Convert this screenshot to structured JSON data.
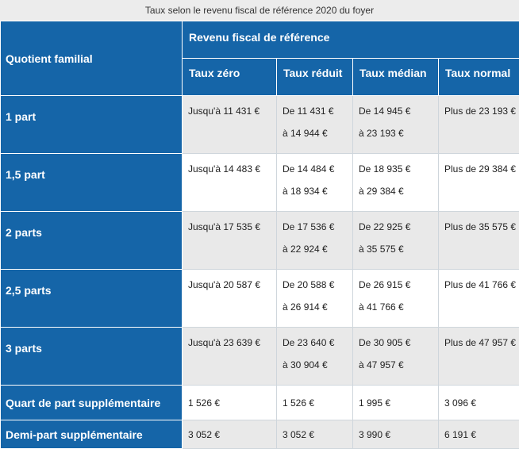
{
  "caption": "Taux selon le revenu fiscal de référence 2020 du foyer",
  "header": {
    "quotient": "Quotient familial",
    "revenu": "Revenu fiscal de référence",
    "columns": [
      "Taux zéro",
      "Taux réduit",
      "Taux médian",
      "Taux normal"
    ]
  },
  "rows": [
    {
      "label": "1 part",
      "zero": "Jusqu'à 11 431 €",
      "reduit_1": "De 11 431 €",
      "reduit_2": "à 14 944 €",
      "median_1": "De 14 945 €",
      "median_2": "à 23 193 €",
      "normal": "Plus de 23 193 €"
    },
    {
      "label": "1,5 part",
      "zero": "Jusqu'à 14 483 €",
      "reduit_1": "De 14 484 €",
      "reduit_2": "à 18 934 €",
      "median_1": "De 18 935 €",
      "median_2": "à 29 384 €",
      "normal": "Plus de 29 384 €"
    },
    {
      "label": "2 parts",
      "zero": "Jusqu'à 17 535 €",
      "reduit_1": "De 17 536 €",
      "reduit_2": "à 22 924 €",
      "median_1": "De 22 925 €",
      "median_2": "à 35 575 €",
      "normal": "Plus de 35 575 €"
    },
    {
      "label": "2,5 parts",
      "zero": "Jusqu'à 20 587 €",
      "reduit_1": "De 20 588 €",
      "reduit_2": "à 26 914 €",
      "median_1": "De 26 915 €",
      "median_2": "à 41 766 €",
      "normal": "Plus de 41 766 €"
    },
    {
      "label": "3 parts",
      "zero": "Jusqu'à 23 639 €",
      "reduit_1": "De 23 640 €",
      "reduit_2": "à 30 904 €",
      "median_1": "De 30 905 €",
      "median_2": "à 47 957 €",
      "normal": "Plus de 47 957 €"
    },
    {
      "label": "Quart de part supplémentaire",
      "zero": "1 526 €",
      "reduit": "1 526 €",
      "median": "1 995 €",
      "normal": "3 096 €"
    },
    {
      "label": "Demi-part supplémentaire",
      "zero": "3 052 €",
      "reduit": "3 052 €",
      "median": "3 990 €",
      "normal": "6 191 €"
    }
  ],
  "colors": {
    "header_blue": "#1565a8",
    "row_gray": "#e9e9e9",
    "row_white": "#ffffff"
  }
}
